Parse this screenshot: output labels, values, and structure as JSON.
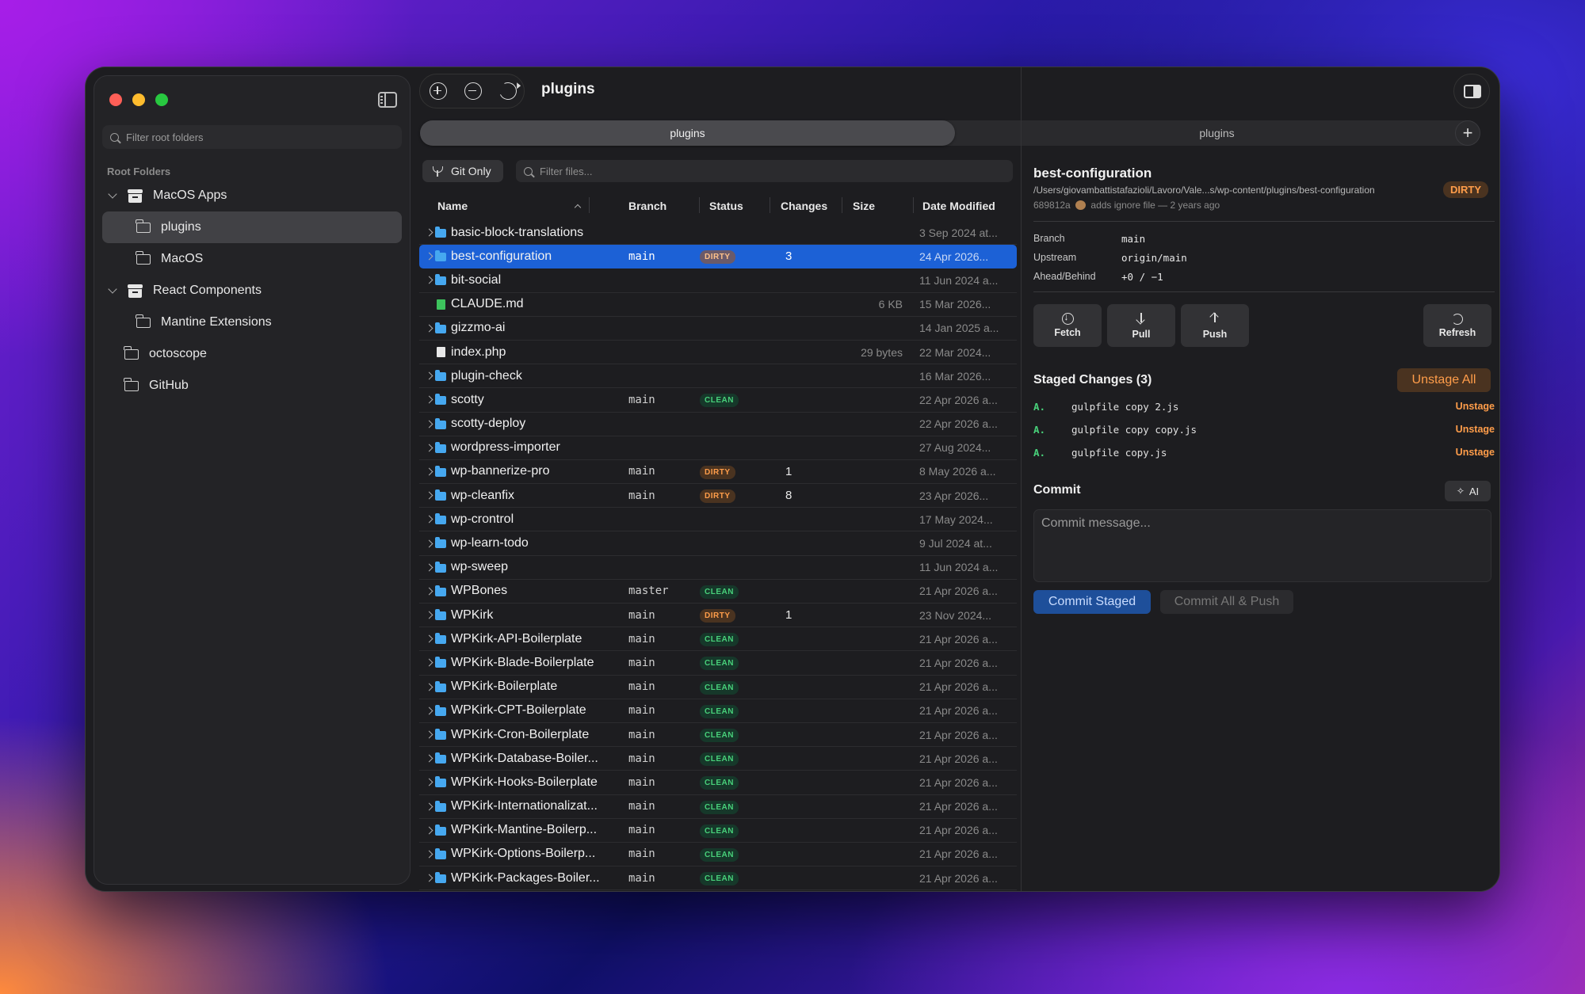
{
  "sidebar": {
    "filter_placeholder": "Filter root folders",
    "section_label": "Root Folders",
    "items": [
      {
        "label": "MacOS Apps"
      },
      {
        "label": "plugins"
      },
      {
        "label": "MacOS"
      },
      {
        "label": "React Components"
      },
      {
        "label": "Mantine Extensions"
      },
      {
        "label": "octoscope"
      },
      {
        "label": "GitHub"
      }
    ]
  },
  "header": {
    "title": "plugins"
  },
  "tabs": [
    {
      "label": "plugins"
    },
    {
      "label": "plugins"
    }
  ],
  "tab_add_label": "+",
  "filters": {
    "git_only_label": "Git Only",
    "files_placeholder": "Filter files..."
  },
  "columns": {
    "name": "Name",
    "branch": "Branch",
    "status": "Status",
    "changes": "Changes",
    "size": "Size",
    "date": "Date Modified"
  },
  "rows": [
    {
      "name": "basic-block-translations",
      "branch": "",
      "status": "",
      "changes": "",
      "size": "",
      "date": "3 Sep 2024 at...",
      "type": "folder"
    },
    {
      "name": "best-configuration",
      "branch": "main",
      "status": "DIRTY",
      "changes": "3",
      "size": "",
      "date": "24 Apr 2026...",
      "type": "folder"
    },
    {
      "name": "bit-social",
      "branch": "",
      "status": "",
      "changes": "",
      "size": "",
      "date": "11 Jun 2024 a...",
      "type": "folder"
    },
    {
      "name": "CLAUDE.md",
      "branch": "",
      "status": "",
      "changes": "",
      "size": "6 KB",
      "date": "15 Mar 2026...",
      "type": "md"
    },
    {
      "name": "gizzmo-ai",
      "branch": "",
      "status": "",
      "changes": "",
      "size": "",
      "date": "14 Jan 2025 a...",
      "type": "folder"
    },
    {
      "name": "index.php",
      "branch": "",
      "status": "",
      "changes": "",
      "size": "29 bytes",
      "date": "22 Mar 2024...",
      "type": "file"
    },
    {
      "name": "plugin-check",
      "branch": "",
      "status": "",
      "changes": "",
      "size": "",
      "date": "16 Mar 2026...",
      "type": "folder"
    },
    {
      "name": "scotty",
      "branch": "main",
      "status": "CLEAN",
      "changes": "",
      "size": "",
      "date": "22 Apr 2026 a...",
      "type": "folder"
    },
    {
      "name": "scotty-deploy",
      "branch": "",
      "status": "",
      "changes": "",
      "size": "",
      "date": "22 Apr 2026 a...",
      "type": "folder"
    },
    {
      "name": "wordpress-importer",
      "branch": "",
      "status": "",
      "changes": "",
      "size": "",
      "date": "27 Aug 2024...",
      "type": "folder"
    },
    {
      "name": "wp-bannerize-pro",
      "branch": "main",
      "status": "DIRTY",
      "changes": "1",
      "size": "",
      "date": "8 May 2026 a...",
      "type": "folder"
    },
    {
      "name": "wp-cleanfix",
      "branch": "main",
      "status": "DIRTY",
      "changes": "8",
      "size": "",
      "date": "23 Apr 2026...",
      "type": "folder"
    },
    {
      "name": "wp-crontrol",
      "branch": "",
      "status": "",
      "changes": "",
      "size": "",
      "date": "17 May 2024...",
      "type": "folder"
    },
    {
      "name": "wp-learn-todo",
      "branch": "",
      "status": "",
      "changes": "",
      "size": "",
      "date": "9 Jul 2024 at...",
      "type": "folder"
    },
    {
      "name": "wp-sweep",
      "branch": "",
      "status": "",
      "changes": "",
      "size": "",
      "date": "11 Jun 2024 a...",
      "type": "folder"
    },
    {
      "name": "WPBones",
      "branch": "master",
      "status": "CLEAN",
      "changes": "",
      "size": "",
      "date": "21 Apr 2026 a...",
      "type": "folder"
    },
    {
      "name": "WPKirk",
      "branch": "main",
      "status": "DIRTY",
      "changes": "1",
      "size": "",
      "date": "23 Nov 2024...",
      "type": "folder"
    },
    {
      "name": "WPKirk-API-Boilerplate",
      "branch": "main",
      "status": "CLEAN",
      "changes": "",
      "size": "",
      "date": "21 Apr 2026 a...",
      "type": "folder"
    },
    {
      "name": "WPKirk-Blade-Boilerplate",
      "branch": "main",
      "status": "CLEAN",
      "changes": "",
      "size": "",
      "date": "21 Apr 2026 a...",
      "type": "folder"
    },
    {
      "name": "WPKirk-Boilerplate",
      "branch": "main",
      "status": "CLEAN",
      "changes": "",
      "size": "",
      "date": "21 Apr 2026 a...",
      "type": "folder"
    },
    {
      "name": "WPKirk-CPT-Boilerplate",
      "branch": "main",
      "status": "CLEAN",
      "changes": "",
      "size": "",
      "date": "21 Apr 2026 a...",
      "type": "folder"
    },
    {
      "name": "WPKirk-Cron-Boilerplate",
      "branch": "main",
      "status": "CLEAN",
      "changes": "",
      "size": "",
      "date": "21 Apr 2026 a...",
      "type": "folder"
    },
    {
      "name": "WPKirk-Database-Boiler...",
      "branch": "main",
      "status": "CLEAN",
      "changes": "",
      "size": "",
      "date": "21 Apr 2026 a...",
      "type": "folder"
    },
    {
      "name": "WPKirk-Hooks-Boilerplate",
      "branch": "main",
      "status": "CLEAN",
      "changes": "",
      "size": "",
      "date": "21 Apr 2026 a...",
      "type": "folder"
    },
    {
      "name": "WPKirk-Internationalizat...",
      "branch": "main",
      "status": "CLEAN",
      "changes": "",
      "size": "",
      "date": "21 Apr 2026 a...",
      "type": "folder"
    },
    {
      "name": "WPKirk-Mantine-Boilerp...",
      "branch": "main",
      "status": "CLEAN",
      "changes": "",
      "size": "",
      "date": "21 Apr 2026 a...",
      "type": "folder"
    },
    {
      "name": "WPKirk-Options-Boilerp...",
      "branch": "main",
      "status": "CLEAN",
      "changes": "",
      "size": "",
      "date": "21 Apr 2026 a...",
      "type": "folder"
    },
    {
      "name": "WPKirk-Packages-Boiler...",
      "branch": "main",
      "status": "CLEAN",
      "changes": "",
      "size": "",
      "date": "21 Apr 2026 a...",
      "type": "folder"
    }
  ],
  "detail": {
    "repo_name": "best-configuration",
    "path": "/Users/giovambattistafazioli/Lavoro/Vale...s/wp-content/plugins/best-configuration",
    "status_badge": "DIRTY",
    "commit_hash": "689812a",
    "commit_msg": "adds ignore file — 2 years ago",
    "branch_label": "Branch",
    "branch_value": "main",
    "upstream_label": "Upstream",
    "upstream_value": "origin/main",
    "ahead_label": "Ahead/Behind",
    "ahead_value": "+0 / −1",
    "actions": {
      "fetch": "Fetch",
      "pull": "Pull",
      "push": "Push",
      "refresh": "Refresh"
    },
    "staged_title": "Staged Changes (3)",
    "unstage_all": "Unstage All",
    "staged": [
      {
        "status": "A.",
        "file": "gulpfile copy 2.js",
        "action": "Unstage"
      },
      {
        "status": "A.",
        "file": "gulpfile copy copy.js",
        "action": "Unstage"
      },
      {
        "status": "A.",
        "file": "gulpfile copy.js",
        "action": "Unstage"
      }
    ],
    "commit_title": "Commit",
    "ai_label": "AI",
    "commit_placeholder": "Commit message...",
    "commit_staged": "Commit Staged",
    "commit_all_push": "Commit All & Push"
  },
  "colors": {
    "accent": "#1c61d6",
    "dirty": "#ff9d4a",
    "clean": "#48d07a",
    "folder": "#46a8f0"
  }
}
